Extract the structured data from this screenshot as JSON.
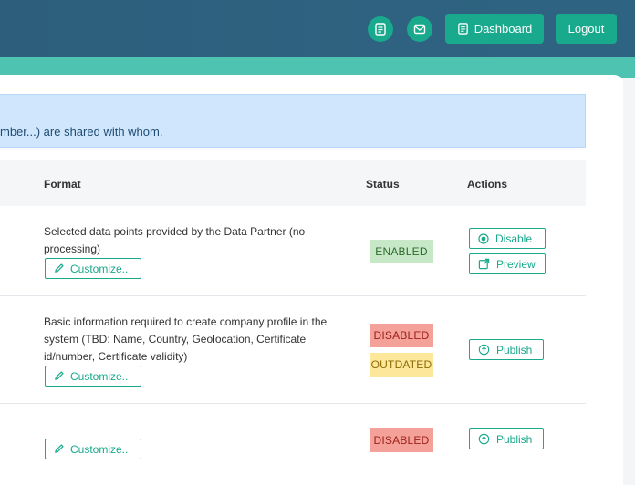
{
  "header": {
    "dashboard_label": "Dashboard",
    "logout_label": "Logout"
  },
  "info_text": "mber...) are shared with whom.",
  "table": {
    "columns": {
      "format": "Format",
      "status": "Status",
      "actions": "Actions"
    },
    "rows": [
      {
        "format": "Selected data points provided by the Data Partner (no processing)",
        "customize": "Customize..",
        "statuses": [
          "ENABLED"
        ],
        "actions": [
          "Disable",
          "Preview"
        ]
      },
      {
        "format": "Basic information required to create company profile in the system (TBD: Name, Country, Geolocation, Certificate id/number, Certificate validity)",
        "customize": "Customize..",
        "statuses": [
          "DISABLED",
          "OUTDATED"
        ],
        "actions": [
          "Publish"
        ]
      },
      {
        "format": "",
        "customize": "Customize..",
        "statuses": [
          "DISABLED"
        ],
        "actions": [
          "Publish"
        ]
      }
    ]
  },
  "colors": {
    "header_bg": "#2d5f7c",
    "accent": "#4fc3b2",
    "primary": "#19a98c",
    "enabled_bg": "#c6e8c6",
    "disabled_bg": "#f4a199",
    "outdated_bg": "#fde79b",
    "info_bg": "#cfe6fc"
  },
  "icons": {
    "header_circle_1": "document-icon",
    "header_circle_2": "mail-icon",
    "dashboard": "document-icon",
    "customize": "pencil-icon",
    "disable": "record-icon",
    "preview": "external-link-icon",
    "publish": "cloud-upload-icon"
  }
}
